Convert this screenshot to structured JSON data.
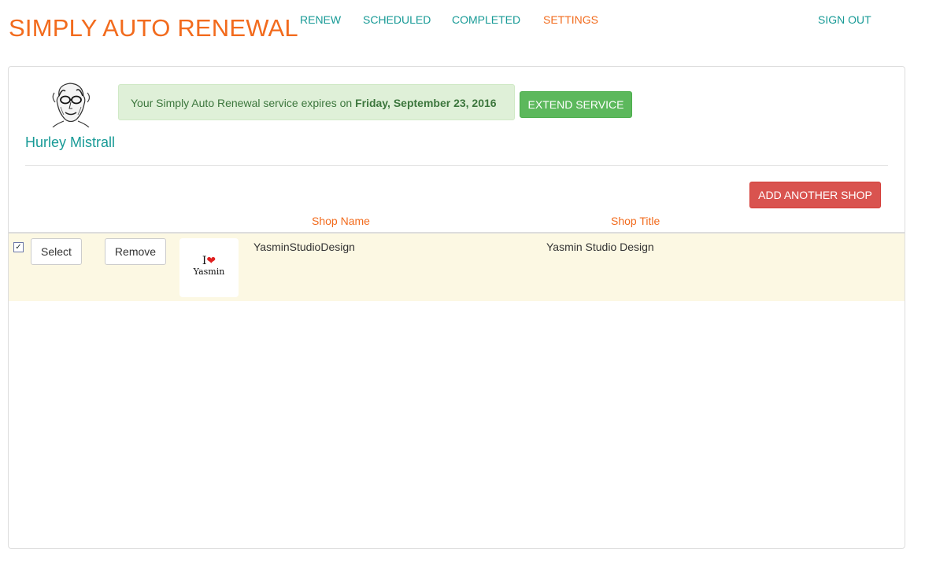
{
  "header": {
    "brand": "SIMPLY AUTO RENEWAL",
    "nav": {
      "renew": "RENEW",
      "scheduled": "SCHEDULED",
      "completed": "COMPLETED",
      "settings": "SETTINGS",
      "sign_out": "SIGN OUT"
    },
    "active_tab": "SETTINGS"
  },
  "profile": {
    "name": "Hurley Mistrall"
  },
  "notice": {
    "text": "Your Simply Auto Renewal service expires on ",
    "date": "Friday, September 23, 2016"
  },
  "buttons": {
    "extend": "EXTEND SERVICE",
    "add_shop": "ADD ANOTHER SHOP"
  },
  "table": {
    "columns": [
      "Shop Name",
      "Shop Title"
    ],
    "rows": [
      {
        "checked": true,
        "select_label": "Select",
        "remove_label": "Remove",
        "logo_top": "I",
        "logo_name": "Yasmin",
        "shop_name": "YasminStudioDesign",
        "shop_title": "Yasmin Studio Design"
      }
    ]
  },
  "colors": {
    "brand": "#f26b1d",
    "link": "#179a96",
    "success": "#5cb85c",
    "danger": "#d9534f",
    "row_highlight": "#fcf8e3"
  }
}
